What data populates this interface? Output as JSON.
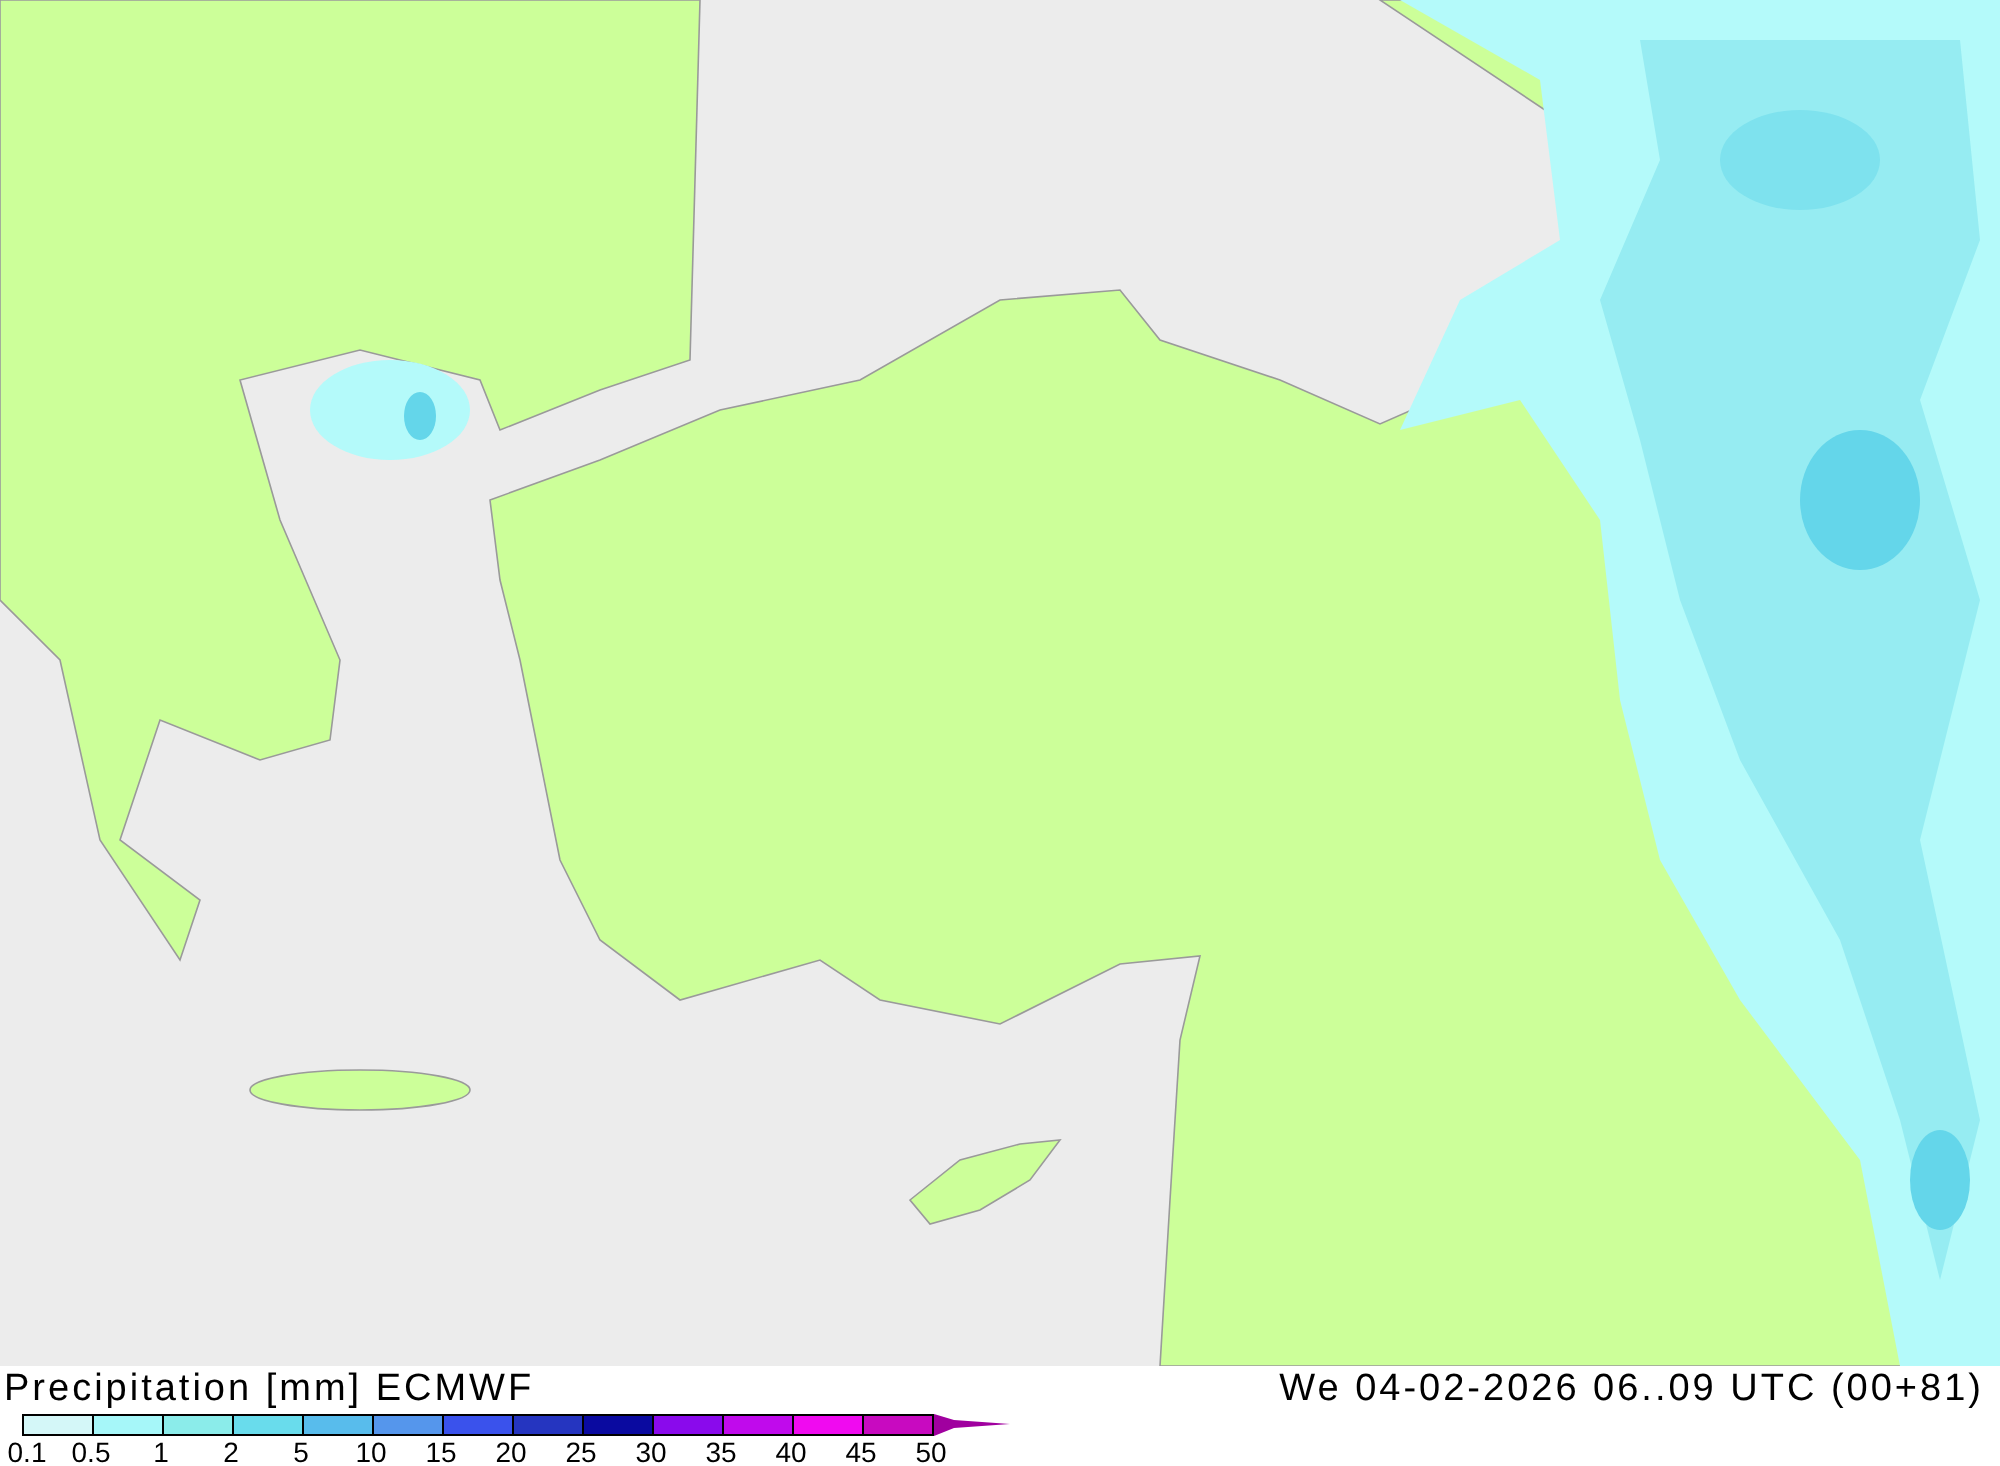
{
  "title": "Precipitation [mm] ECMWF",
  "valid_time": "We 04-02-2026 06..09 UTC (00+81)",
  "legend": {
    "bins": [
      {
        "color": "#d4f7f8"
      },
      {
        "color": "#a6f7f9"
      },
      {
        "color": "#8becea"
      },
      {
        "color": "#69dcec"
      },
      {
        "color": "#58bcec"
      },
      {
        "color": "#5596ec"
      },
      {
        "color": "#3a52ec"
      },
      {
        "color": "#2535c0"
      },
      {
        "color": "#0a0aa0"
      },
      {
        "color": "#8a0aec"
      },
      {
        "color": "#c00aec"
      },
      {
        "color": "#f00af0"
      },
      {
        "color": "#c80ac0"
      }
    ],
    "overflow": {
      "color": "#a0009f"
    },
    "labels": [
      "0.1",
      "0.5",
      "1",
      "2",
      "5",
      "10",
      "15",
      "20",
      "25",
      "30",
      "35",
      "40",
      "45",
      "50"
    ]
  }
}
